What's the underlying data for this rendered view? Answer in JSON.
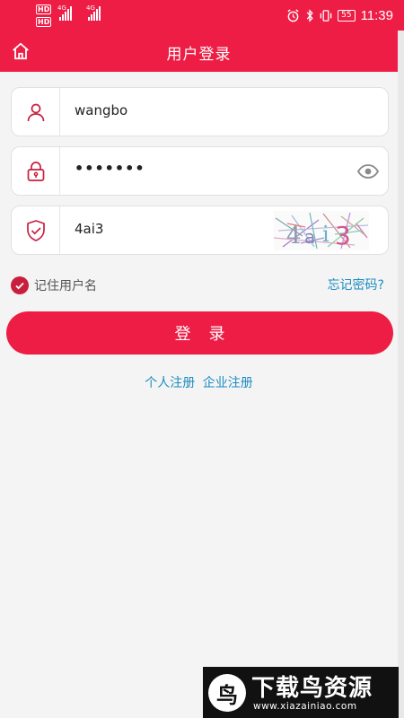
{
  "status_bar": {
    "hd1": "HD",
    "hd2": "HD",
    "net1": "4G",
    "net2": "4G",
    "battery": "55",
    "time": "11:39"
  },
  "header": {
    "title": "用户登录",
    "home_icon": "home-icon"
  },
  "form": {
    "username": {
      "value": "wangbo",
      "icon": "user-icon"
    },
    "password": {
      "value": "•••••••",
      "icon": "lock-icon",
      "toggle_icon": "eye-icon"
    },
    "captcha": {
      "value": "4ai3",
      "icon": "shield-check-icon",
      "image_text": "4ai3"
    }
  },
  "remember": {
    "label": "记住用户名",
    "checked": true
  },
  "forgot_label": "忘记密码?",
  "login_label": "登录",
  "register": {
    "personal": "个人注册",
    "enterprise": "企业注册"
  },
  "watermark": {
    "logo_char": "鸟",
    "title": "下载鸟资源",
    "url": "www.xiazainiao.com"
  },
  "colors": {
    "brand_red": "#ee1d45",
    "link_blue": "#1c8dc0",
    "check_red": "#c91f3f"
  }
}
